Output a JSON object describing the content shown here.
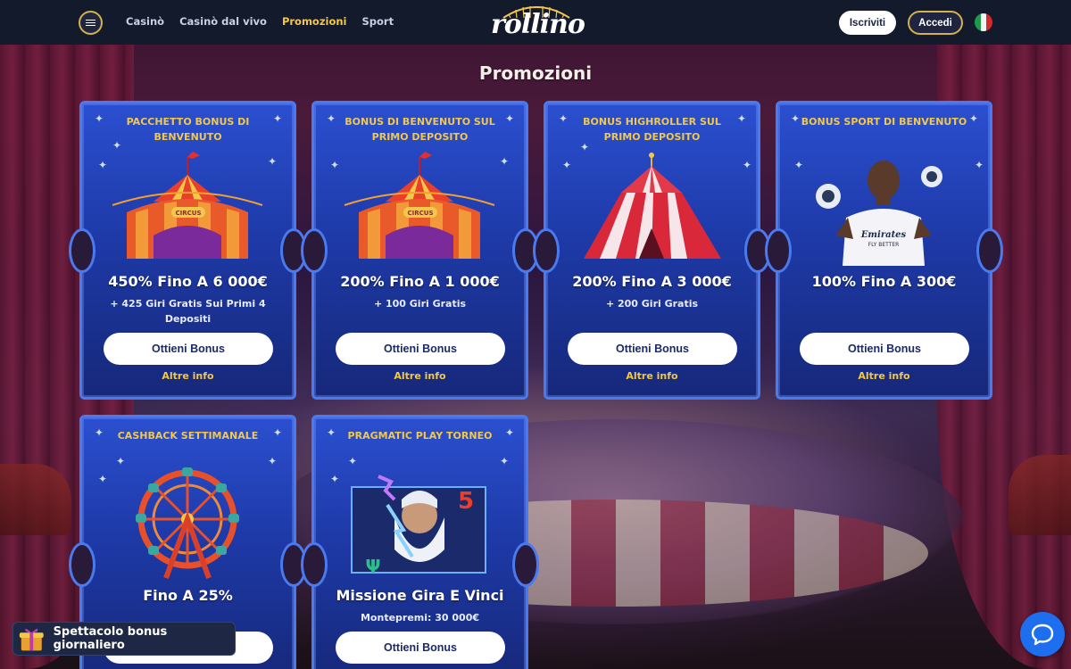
{
  "header": {
    "nav": [
      {
        "label": "Casinò",
        "active": false
      },
      {
        "label": "Casinò dal vivo",
        "active": false
      },
      {
        "label": "Promozioni",
        "active": true
      },
      {
        "label": "Sport",
        "active": false
      }
    ],
    "logo_text": "rollino",
    "signup_label": "Iscriviti",
    "login_label": "Accedi",
    "language_flag": "it-flag"
  },
  "page": {
    "title": "Promozioni"
  },
  "promotions": [
    {
      "title": "PACCHETTO BONUS DI BENVENUTO",
      "headline": "450% Fino A 6 000€",
      "subtitle": "+ 425 Giri Gratis Sui Primi 4 Depositi",
      "button_label": "Ottieni Bonus",
      "link_label": "Altre info",
      "art": "circus-tent-icon"
    },
    {
      "title": "BONUS DI BENVENUTO SUL PRIMO DEPOSITO",
      "headline": "200% Fino A 1 000€",
      "subtitle": "+ 100 Giri Gratis",
      "button_label": "Ottieni Bonus",
      "link_label": "Altre info",
      "art": "circus-tent-icon"
    },
    {
      "title": "BONUS HIGHROLLER SUL PRIMO DEPOSITO",
      "headline": "200% Fino A 3 000€",
      "subtitle": "+ 200 Giri Gratis",
      "button_label": "Ottieni Bonus",
      "link_label": "Altre info",
      "art": "red-tent-icon"
    },
    {
      "title": "BONUS SPORT DI BENVENUTO",
      "headline": "100% Fino A 300€",
      "subtitle": "",
      "button_label": "Ottieni Bonus",
      "link_label": "Altre info",
      "art": "football-player-image",
      "art_jersey_text": "Emirates",
      "art_jersey_subtext": "FLY BETTER"
    },
    {
      "title": "CASHBACK SETTIMANALE",
      "headline": "Fino A 25%",
      "subtitle": "",
      "button_label": "Ottieni Bonus",
      "link_label": "",
      "art": "ferris-wheel-icon"
    },
    {
      "title": "PRAGMATIC PLAY TORNEO",
      "headline": "Missione Gira E Vinci",
      "subtitle": "Montepremi: 30 000€",
      "button_label": "Ottieni Bonus",
      "link_label": "",
      "art": "zeus-slot-icon"
    }
  ],
  "widgets": {
    "daily_bonus_label": "Spettacolo bonus giornaliero",
    "daily_bonus_icon": "gift-icon",
    "chat_icon": "chat-icon"
  },
  "colors": {
    "accent_gold": "#f2c84a",
    "card_blue": "#1e3aa8",
    "card_border": "#4a7af0",
    "header_bg": "#131a2c",
    "chat_blue": "#1e6ff0"
  }
}
